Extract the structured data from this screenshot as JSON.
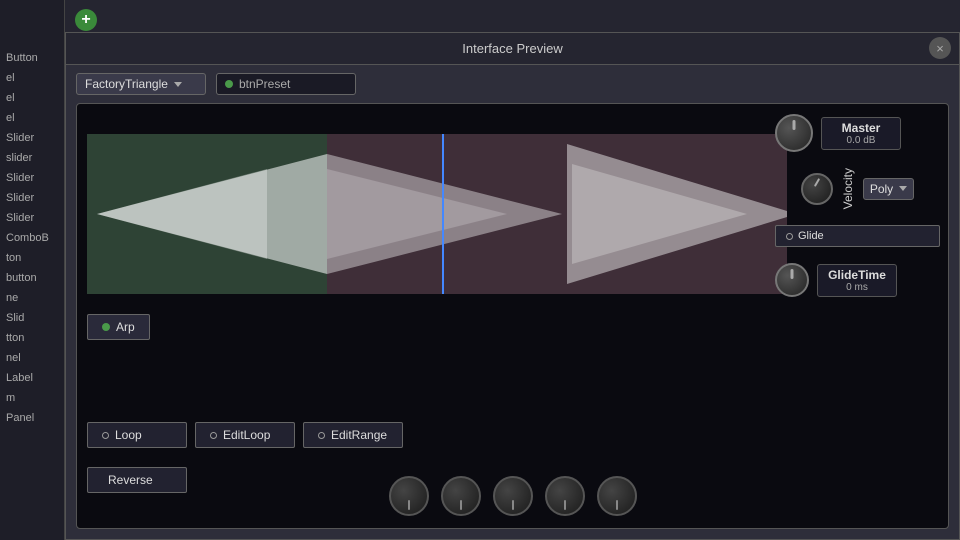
{
  "window": {
    "title": "Interface Preview",
    "close_label": "×"
  },
  "toolbar": {
    "add_icon": "+",
    "preset_dropdown": "FactoryTriangle",
    "preset_input": "btnPreset"
  },
  "sidebar": {
    "items": [
      {
        "label": "Button"
      },
      {
        "label": "el"
      },
      {
        "label": "el"
      },
      {
        "label": "el"
      },
      {
        "label": "Slider"
      },
      {
        "label": "slider"
      },
      {
        "label": "Slider"
      },
      {
        "label": "Slider"
      },
      {
        "label": "Slider"
      },
      {
        "label": "ComboB"
      },
      {
        "label": "ton"
      },
      {
        "label": "button"
      },
      {
        "label": "ne"
      },
      {
        "label": "Slid"
      },
      {
        "label": "tton"
      },
      {
        "label": "nel"
      },
      {
        "label": "Label"
      },
      {
        "label": "m"
      },
      {
        "label": "Panel"
      }
    ]
  },
  "controls": {
    "arp_label": "Arp",
    "loop_label": "Loop",
    "edit_loop_label": "EditLoop",
    "edit_range_label": "EditRange",
    "reverse_label": "Reverse",
    "velocity_label": "Velocity",
    "master_label": "Master",
    "master_value": "0.0 dB",
    "poly_label": "Poly",
    "glide_label": "Glide",
    "glide_time_label": "GlideTime",
    "glide_time_value": "0 ms"
  }
}
